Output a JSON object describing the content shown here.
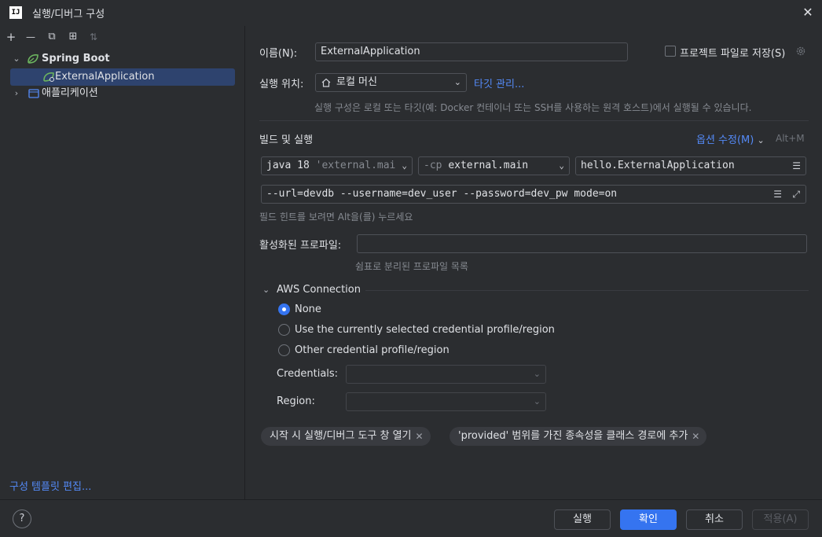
{
  "window": {
    "title": "실행/디버그 구성",
    "app_icon": "IJ",
    "close_glyph": "✕"
  },
  "left": {
    "toolbar": {
      "add": "+",
      "remove": "—",
      "copy": "⧉",
      "new_folder": "⊞",
      "sort": "⇅"
    },
    "tree": {
      "group_label": "Spring Boot",
      "child_label": "ExternalApplication",
      "other_label": "애플리케이션"
    },
    "edit_templates": "구성 템플릿 편집..."
  },
  "form": {
    "name_label": "이름(N):",
    "name_value": "ExternalApplication",
    "store_as_project_file": "프로젝트 파일로 저장(S)",
    "run_on_label": "실행 위치:",
    "run_on_value": "로컬 머신",
    "manage_targets": "타깃 관리...",
    "run_on_hint": "실행 구성은 로컬 또는 타깃(예: Docker 컨테이너 또는 SSH를 사용하는 원격 호스트)에서 실행될 수 있습니다.",
    "build_run_label": "빌드 및 실행",
    "modify_options": "옵션 수정(M)",
    "modify_shortcut": "Alt+M",
    "jdk_prefix": "java 18",
    "jdk_detail": "'external.mai",
    "cp_prefix": "-cp",
    "cp_value": "external.main",
    "main_class": "hello.ExternalApplication",
    "program_args": "--url=devdb --username=dev_user --password=dev_pw mode=on",
    "field_hint": "필드 힌트를 보려면 Alt을(를) 누르세요",
    "active_profiles_label": "활성화된 프로파일:",
    "active_profiles_value": "",
    "active_profiles_hint": "쉼표로 분리된 프로파일 목록"
  },
  "aws": {
    "section_title": "AWS Connection",
    "options": [
      {
        "label": "None",
        "checked": true
      },
      {
        "label": "Use the currently selected credential profile/region",
        "checked": false
      },
      {
        "label": "Other credential profile/region",
        "checked": false
      }
    ],
    "credentials_label": "Credentials:",
    "region_label": "Region:"
  },
  "chips": [
    "시작 시 실행/디버그 도구 창 열기",
    "'provided' 범위를 가진 종속성을 클래스 경로에 추가"
  ],
  "footer": {
    "help": "?",
    "run": "실행",
    "ok": "확인",
    "cancel": "취소",
    "apply": "적용(A)"
  },
  "colors": {
    "accent": "#3574f0",
    "link": "#548af7",
    "selection": "#2e436e",
    "background": "#2b2d30"
  }
}
